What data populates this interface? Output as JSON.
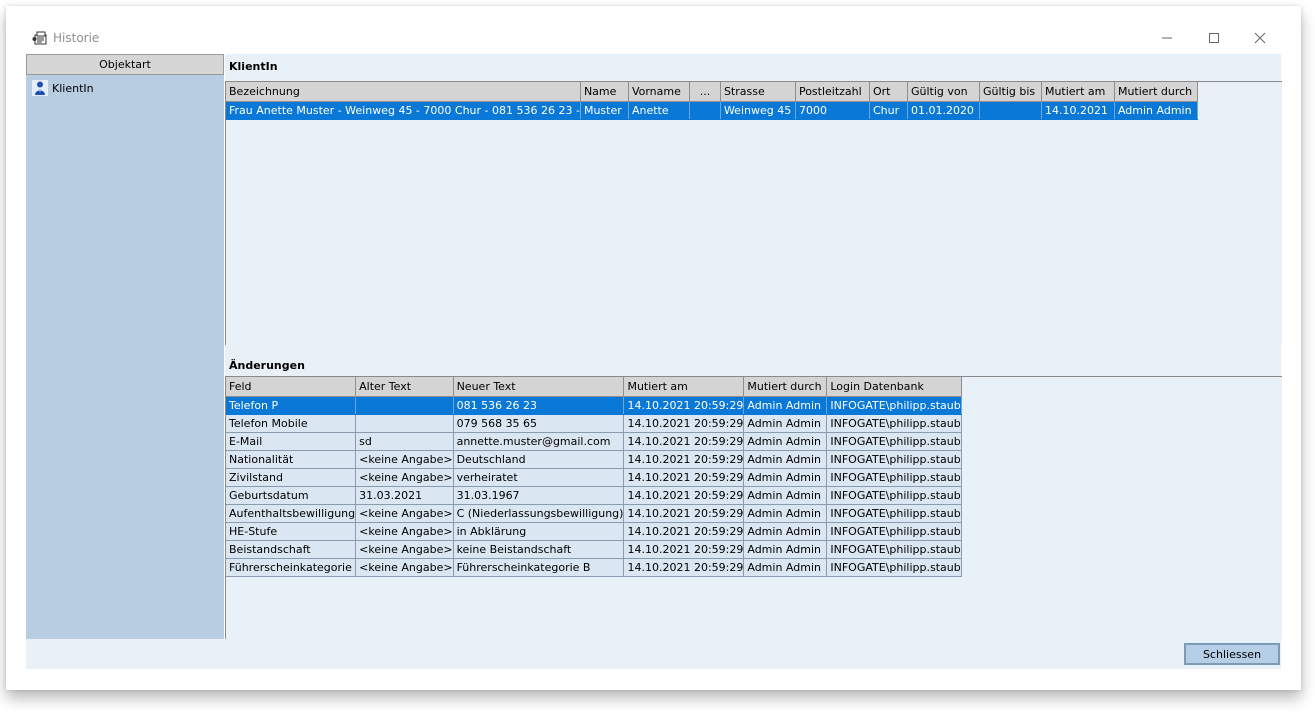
{
  "window": {
    "title": "Historie"
  },
  "left": {
    "header": "Objektart",
    "items": [
      {
        "label": "KlientIn",
        "icon": "person-icon"
      }
    ]
  },
  "top": {
    "title": "KlientIn",
    "columns": [
      "Bezeichnung",
      "Name",
      "Vorname",
      "...",
      "Strasse",
      "Postleitzahl",
      "Ort",
      "Gültig von",
      "Gültig bis",
      "Mutiert am",
      "Mutiert durch"
    ],
    "rows": [
      [
        "Frau Anette Muster -  Weinweg 45 -  7000 Chur -  081 536 26 23 -",
        "Muster",
        "Anette",
        "",
        "Weinweg 45",
        "7000",
        "Chur",
        "01.01.2020",
        "",
        "14.10.2021",
        "Admin Admin"
      ]
    ]
  },
  "bottom": {
    "title": "Änderungen",
    "columns": [
      "Feld",
      "Alter Text",
      "Neuer Text",
      "Mutiert am",
      "Mutiert durch",
      "Login Datenbank"
    ],
    "rows": [
      [
        "Telefon P",
        "",
        "081 536 26 23",
        "14.10.2021 20:59:29",
        "Admin Admin",
        "INFOGATE\\philipp.staub"
      ],
      [
        "Telefon Mobile",
        "",
        "079 568 35 65",
        "14.10.2021 20:59:29",
        "Admin Admin",
        "INFOGATE\\philipp.staub"
      ],
      [
        "E-Mail",
        "sd",
        "annette.muster@gmail.com",
        "14.10.2021 20:59:29",
        "Admin Admin",
        "INFOGATE\\philipp.staub"
      ],
      [
        "Nationalität",
        "<keine Angabe>",
        "Deutschland",
        "14.10.2021 20:59:29",
        "Admin Admin",
        "INFOGATE\\philipp.staub"
      ],
      [
        "Zivilstand",
        "<keine Angabe>",
        "verheiratet",
        "14.10.2021 20:59:29",
        "Admin Admin",
        "INFOGATE\\philipp.staub"
      ],
      [
        "Geburtsdatum",
        "31.03.2021",
        "31.03.1967",
        "14.10.2021 20:59:29",
        "Admin Admin",
        "INFOGATE\\philipp.staub"
      ],
      [
        "Aufenthaltsbewilligung",
        "<keine Angabe>",
        "C (Niederlassungsbewilligung)",
        "14.10.2021 20:59:29",
        "Admin Admin",
        "INFOGATE\\philipp.staub"
      ],
      [
        "HE-Stufe",
        "<keine Angabe>",
        "in Abklärung",
        "14.10.2021 20:59:29",
        "Admin Admin",
        "INFOGATE\\philipp.staub"
      ],
      [
        "Beistandschaft",
        "<keine Angabe>",
        "keine Beistandschaft",
        "14.10.2021 20:59:29",
        "Admin Admin",
        "INFOGATE\\philipp.staub"
      ],
      [
        "Führerscheinkategorie",
        "<keine Angabe>",
        "Führerscheinkategorie B",
        "14.10.2021 20:59:29",
        "Admin Admin",
        "INFOGATE\\philipp.staub"
      ]
    ]
  },
  "footer": {
    "close_label": "Schliessen"
  },
  "colors": {
    "selection": "#0a78d7",
    "row_bg": "#dae6f2",
    "left_pane": "#b8cde2",
    "area_bg": "#e8f0f8"
  }
}
